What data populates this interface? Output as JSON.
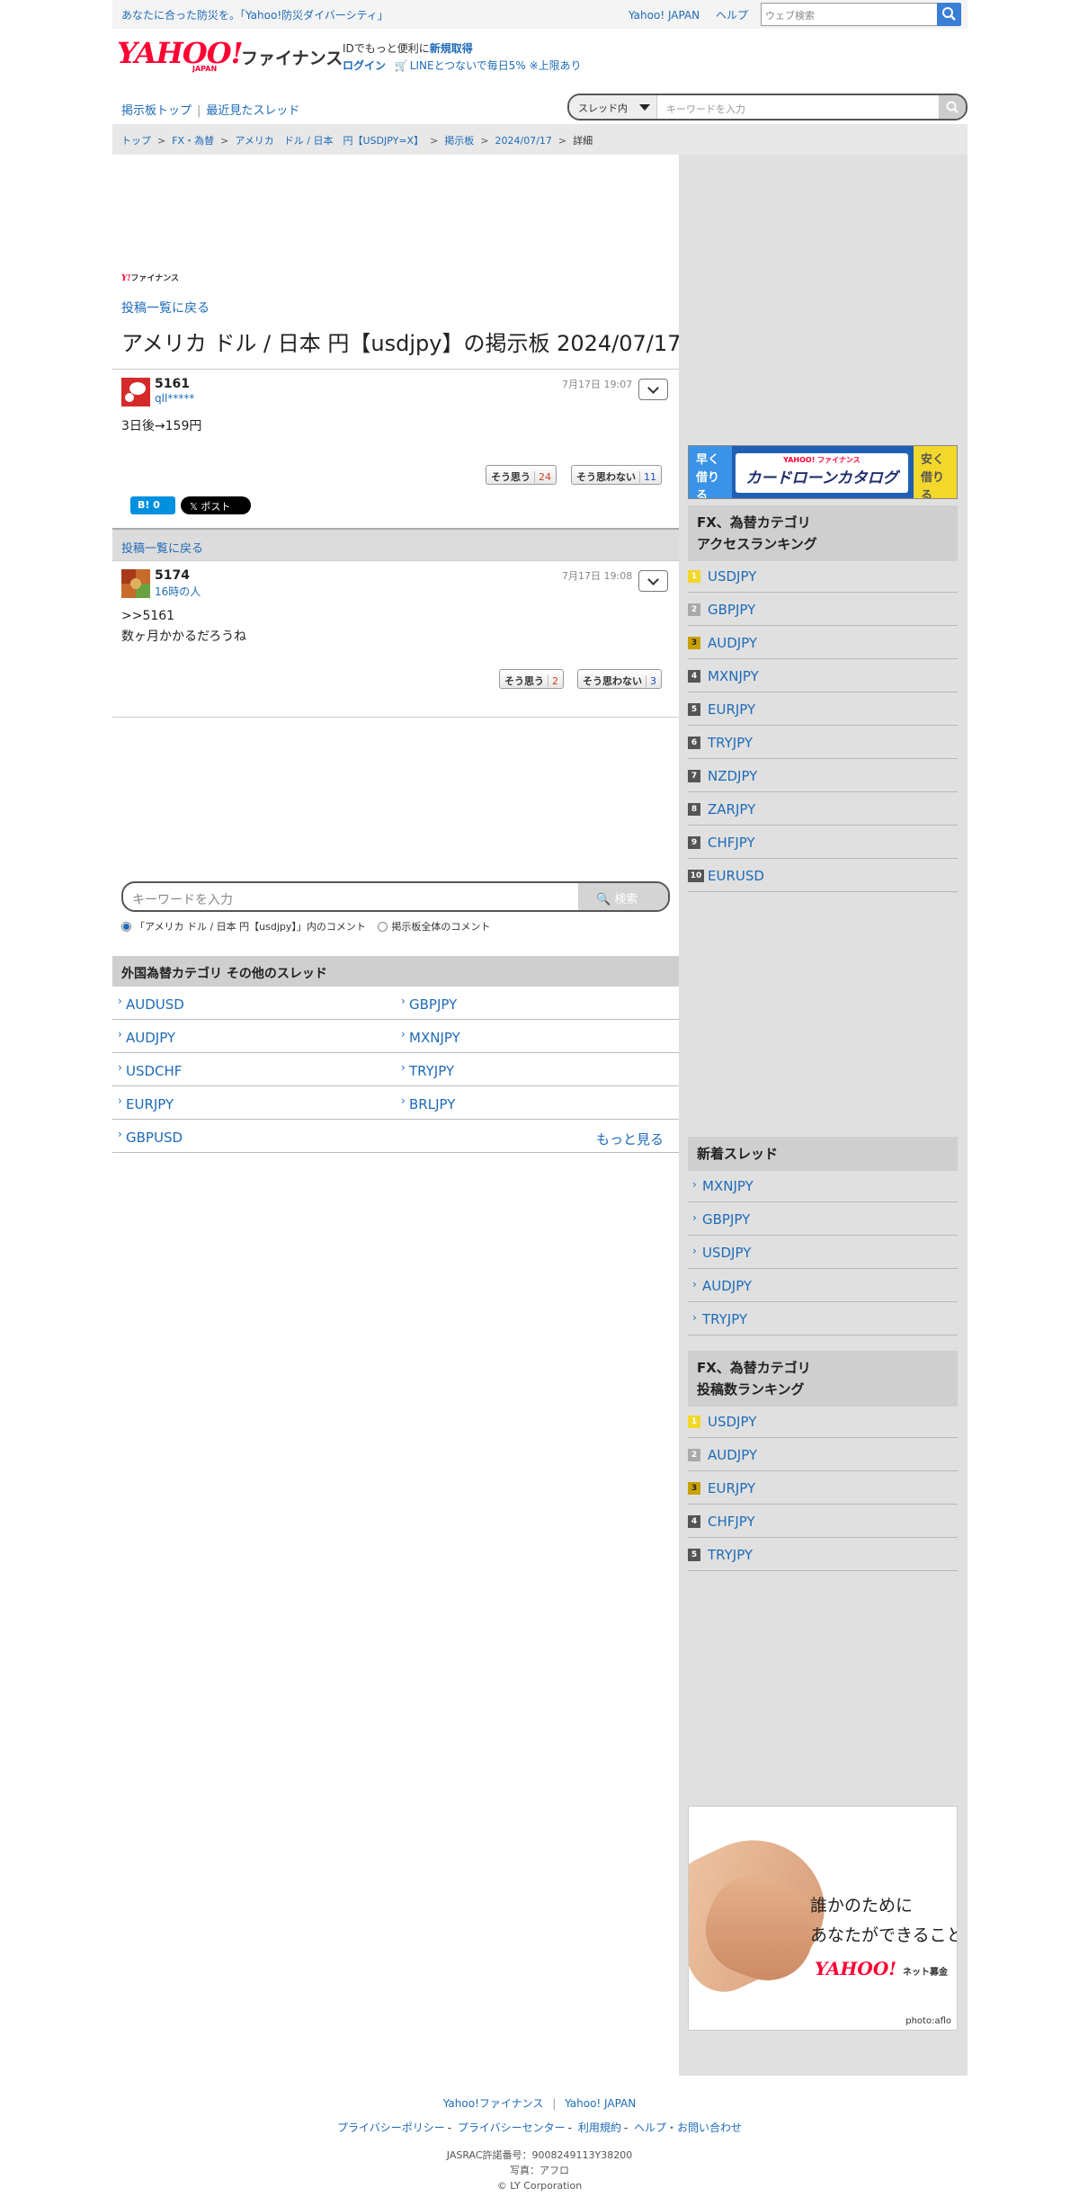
{
  "promo": {
    "message": "あなたに合った防災を。「Yahoo!防災ダイバーシティ」",
    "links": [
      "Yahoo! JAPAN",
      "ヘルプ"
    ],
    "search_placeholder": "ウェブ検索"
  },
  "header": {
    "logo_text": "YAHOO!",
    "logo_sub": "JAPAN",
    "service_name": "ファイナンス",
    "login_line1_prefix": "IDでもっと便利に",
    "login_line1_link": "新規取得",
    "login_line2_link": "ログイン",
    "line_promo": "LINEとつないで毎日5% ※上限あり"
  },
  "boardnav": {
    "links": [
      "掲示板トップ",
      "最近見たスレッド"
    ],
    "scope_label": "スレッド内",
    "keyword_placeholder": "キーワードを入力"
  },
  "breadcrumb": [
    "トップ",
    "FX・為替",
    "アメリカ　ドル / 日本　円【USDJPY=X】",
    "掲示板",
    "2024/07/17",
    "詳細"
  ],
  "main": {
    "fin_small": "ファイナンス",
    "back_link": "投稿一覧に戻る",
    "title": "アメリカ ドル / 日本 円【usdjpy】の掲示板 2024/07/17",
    "posts": [
      {
        "number": "5161",
        "user": "qll*****",
        "time": "7月17日 19:07",
        "body": [
          "3日後→159円"
        ],
        "agree_label": "そう思う",
        "agree_count": "24",
        "disagree_label": "そう思わない",
        "disagree_count": "11"
      },
      {
        "number": "5174",
        "user": "16時の人",
        "time": "7月17日 19:08",
        "body": [
          ">>5161",
          "数ヶ月かかるだろうね"
        ],
        "agree_label": "そう思う",
        "agree_count": "2",
        "disagree_label": "そう思わない",
        "disagree_count": "3"
      }
    ],
    "hatebu_label": "B! 0",
    "xpost_label": "𝕏 ポスト",
    "back_bar": "投稿一覧に戻る",
    "comment_search": {
      "placeholder": "キーワードを入力",
      "button": "検索",
      "radio_thread": "「アメリカ ドル / 日本 円【usdjpy】」内のコメント",
      "radio_all": "掲示板全体のコメント"
    },
    "other_threads_heading": "外国為替カテゴリ  その他のスレッド",
    "other_threads": [
      [
        "AUDUSD",
        "GBPJPY"
      ],
      [
        "AUDJPY",
        "MXNJPY"
      ],
      [
        "USDCHF",
        "TRYJPY"
      ],
      [
        "EURJPY",
        "BRLJPY"
      ],
      [
        "GBPUSD",
        ""
      ]
    ],
    "more_link": "もっと見る"
  },
  "sidebar": {
    "banner": {
      "left": "早く借りる",
      "brand": "YAHOO! ファイナンス",
      "title": "カードローンカタログ",
      "right": "安く借りる"
    },
    "access_ranking_title": [
      "FX、為替カテゴリ",
      "アクセスランキング"
    ],
    "access_ranking": [
      "USDJPY",
      "GBPJPY",
      "AUDJPY",
      "MXNJPY",
      "EURJPY",
      "TRYJPY",
      "NZDJPY",
      "ZARJPY",
      "CHFJPY",
      "EURUSD"
    ],
    "new_threads_title": "新着スレッド",
    "new_threads": [
      "MXNJPY",
      "GBPJPY",
      "USDJPY",
      "AUDJPY",
      "TRYJPY"
    ],
    "post_ranking_title": [
      "FX、為替カテゴリ",
      "投稿数ランキング"
    ],
    "post_ranking": [
      "USDJPY",
      "AUDJPY",
      "EURJPY",
      "CHFJPY",
      "TRYJPY"
    ],
    "ad": {
      "line1": "誰かのために",
      "line2": "あなたができること",
      "logo": "YAHOO!",
      "logo_sub": "ネット募金",
      "credit": "photo:aflo"
    }
  },
  "footer": {
    "links1": [
      "Yahoo!ファイナンス",
      "Yahoo! JAPAN"
    ],
    "links2": [
      "プライバシーポリシー",
      "プライバシーセンター",
      "利用規約",
      "ヘルプ・お問い合わせ"
    ],
    "jasrac": "JASRAC許諾番号：9008249113Y38200",
    "photo": "写真：アフロ",
    "copyright": "© LY Corporation"
  }
}
